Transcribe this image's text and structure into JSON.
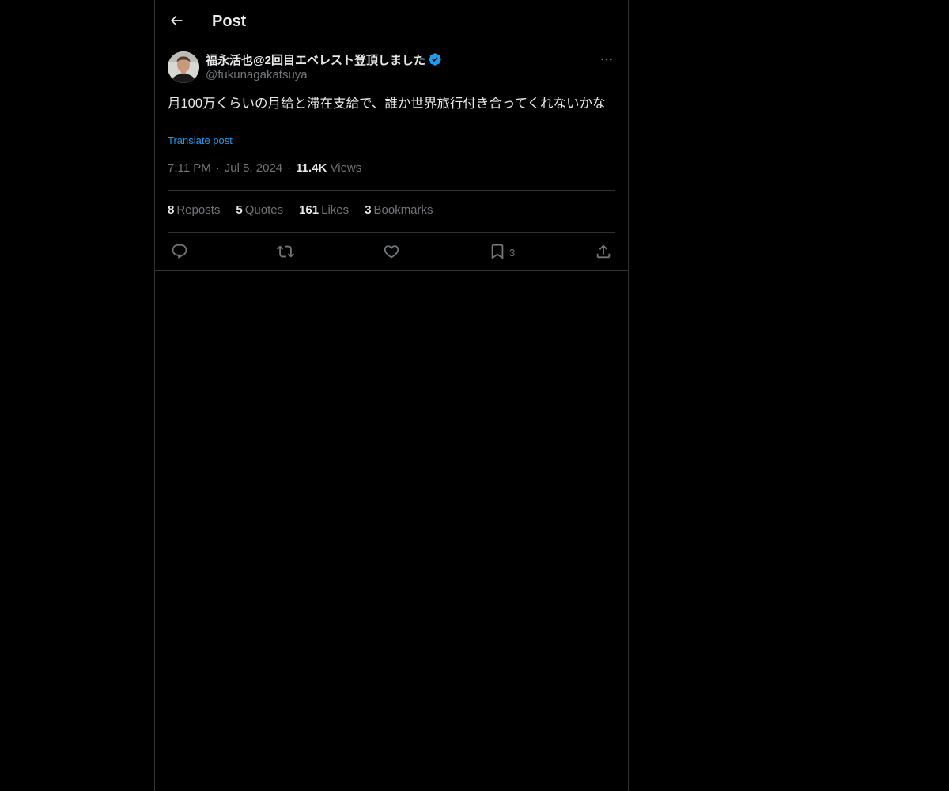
{
  "header": {
    "title": "Post",
    "back_icon": "arrow-left-icon"
  },
  "author": {
    "display_name": "福永活也@2回目エベレスト登頂しました",
    "handle": "@fukunagakatsuya",
    "verified_icon": "verified-badge-icon",
    "verified_color": "#1d9bf0"
  },
  "post": {
    "text": "月100万くらいの月給と滞在支給で、誰か世界旅行付き合ってくれないかな",
    "translate_label": "Translate post",
    "time": "7:11 PM",
    "date": "Jul 5, 2024",
    "dot": "·",
    "views_count": "11.4K",
    "views_label": "Views"
  },
  "stats": {
    "reposts_count": "8",
    "reposts_label": "Reposts",
    "quotes_count": "5",
    "quotes_label": "Quotes",
    "likes_count": "161",
    "likes_label": "Likes",
    "bookmarks_count": "3",
    "bookmarks_label": "Bookmarks"
  },
  "actions": {
    "reply_icon": "reply-icon",
    "repost_icon": "repost-icon",
    "like_icon": "heart-icon",
    "bookmark_icon": "bookmark-icon",
    "bookmark_count": "3",
    "share_icon": "share-icon"
  },
  "colors": {
    "background": "#000000",
    "text": "#e7e9ea",
    "muted": "#71767b",
    "link": "#1d9bf0",
    "border": "#2f3336"
  }
}
